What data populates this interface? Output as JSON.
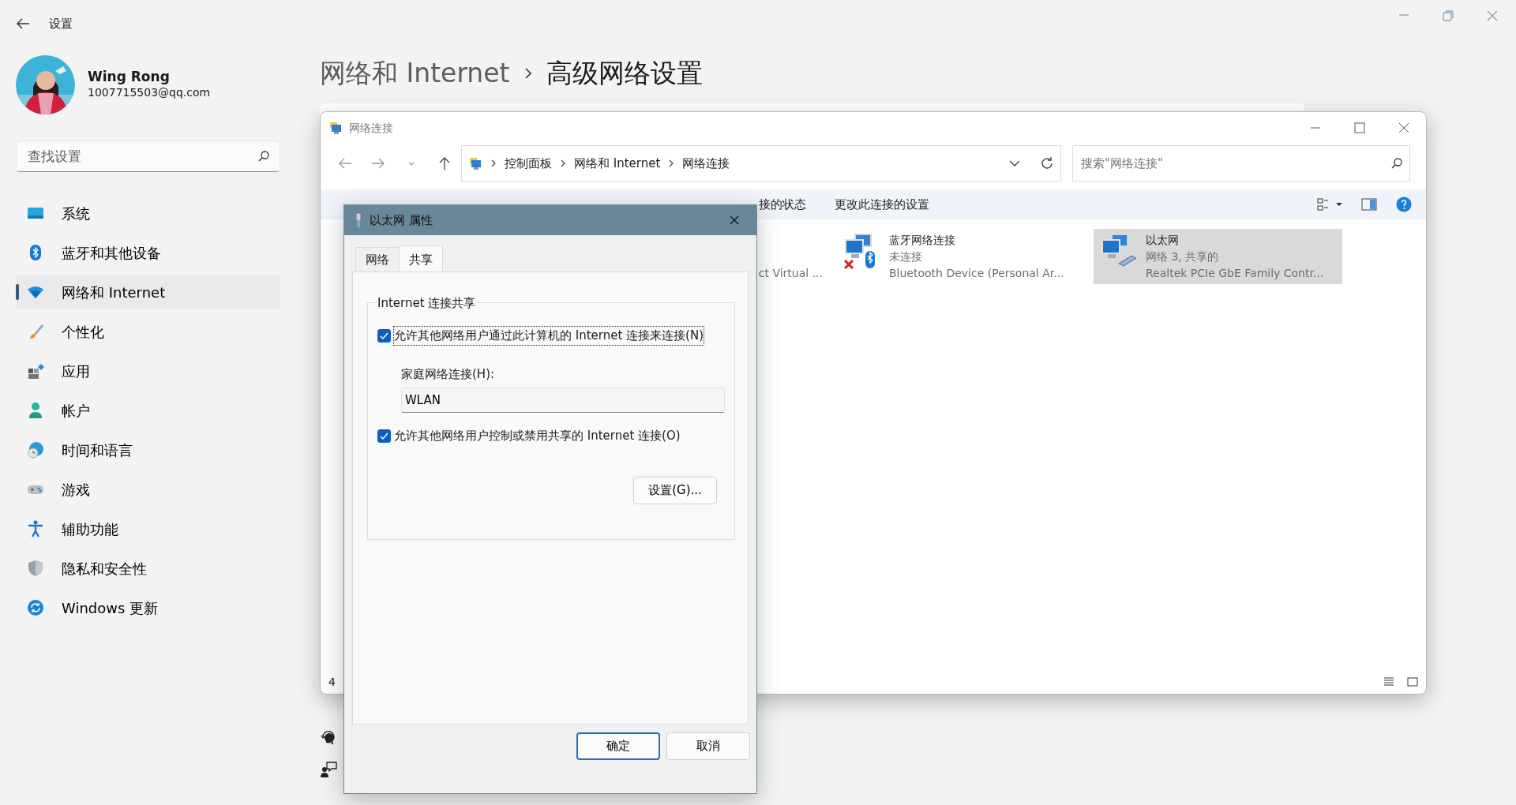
{
  "settings": {
    "title": "设置",
    "user": {
      "name": "Wing Rong",
      "email": "1007715503@qq.com"
    },
    "search": {
      "placeholder": "查找设置"
    },
    "nav": [
      {
        "label": "系统",
        "kind": "system",
        "selected": false
      },
      {
        "label": "蓝牙和其他设备",
        "kind": "bluetooth",
        "selected": false
      },
      {
        "label": "网络和 Internet",
        "kind": "wifi",
        "selected": true
      },
      {
        "label": "个性化",
        "kind": "brush",
        "selected": false
      },
      {
        "label": "应用",
        "kind": "apps",
        "selected": false
      },
      {
        "label": "帐户",
        "kind": "person",
        "selected": false
      },
      {
        "label": "时间和语言",
        "kind": "globe",
        "selected": false
      },
      {
        "label": "游戏",
        "kind": "gamepad",
        "selected": false
      },
      {
        "label": "辅助功能",
        "kind": "accessibility",
        "selected": false
      },
      {
        "label": "隐私和安全性",
        "kind": "shield",
        "selected": false
      },
      {
        "label": "Windows 更新",
        "kind": "update",
        "selected": false
      }
    ],
    "breadcrumb": [
      "网络和 Internet",
      "高级网络设置"
    ]
  },
  "explorer": {
    "title": "网络连接",
    "address": [
      "控制面板",
      "网络和 Internet",
      "网络连接"
    ],
    "search": {
      "placeholder": "搜索\"网络连接\""
    },
    "toolbar": [
      "接的状态",
      "更改此连接的设置"
    ],
    "items": [
      {
        "kind": "partial",
        "device": "ct Virtual ..."
      },
      {
        "kind": "bluetooth",
        "name": "蓝牙网络连接",
        "status": "未连接",
        "device": "Bluetooth Device (Personal Ar...",
        "disconnected": true,
        "selected": false
      },
      {
        "kind": "ethernet",
        "name": "以太网",
        "status": "网络 3, 共享的",
        "device": "Realtek PCIe GbE Family Contr...",
        "disconnected": false,
        "selected": true
      }
    ],
    "status_bar": "4"
  },
  "dialog": {
    "title": "以太网 属性",
    "tabs": [
      {
        "label": "网络",
        "selected": false
      },
      {
        "label": "共享",
        "selected": true
      }
    ],
    "group": "Internet 连接共享",
    "share_option": {
      "label": "允许其他网络用户通过此计算机的 Internet 连接来连接(N)",
      "checked": true
    },
    "home_network": {
      "label": "家庭网络连接(H):",
      "value": "WLAN"
    },
    "control_option": {
      "label": "允许其他网络用户控制或禁用共享的 Internet 连接(O)",
      "checked": true
    },
    "settings_button": "设置(G)...",
    "buttons": [
      {
        "label": "确定",
        "default": true
      },
      {
        "label": "取消",
        "default": false
      }
    ]
  }
}
